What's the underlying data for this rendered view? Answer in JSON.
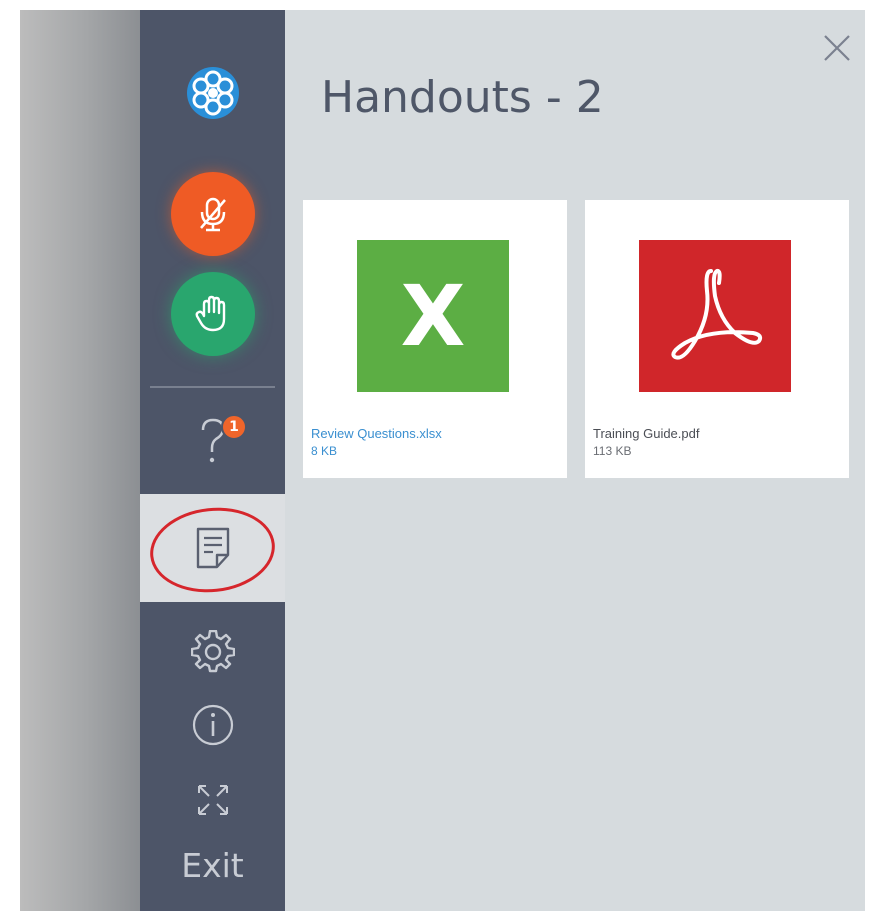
{
  "panel": {
    "title": "Handouts - 2"
  },
  "handouts": [
    {
      "name": "Review Questions.xlsx",
      "size": "8 KB",
      "type_icon": "excel-file-icon",
      "icon_letter": "X",
      "color": "#5cae44"
    },
    {
      "name": "Training Guide.pdf",
      "size": "113 KB",
      "type_icon": "pdf-file-icon",
      "color": "#d0262a"
    }
  ],
  "sidebar": {
    "questions_badge": "1",
    "exit_label": "Exit",
    "icons": [
      "app-logo-icon",
      "microphone-muted-icon",
      "raise-hand-icon",
      "question-icon",
      "handouts-icon",
      "gear-icon",
      "info-icon",
      "fullscreen-icon"
    ]
  },
  "colors": {
    "sidebar": "#4d5568",
    "mute": "#ef5b25",
    "hand": "#29a66e",
    "panel": "#d6dbde",
    "highlight": "#d6262c",
    "link": "#3a8fd0"
  }
}
